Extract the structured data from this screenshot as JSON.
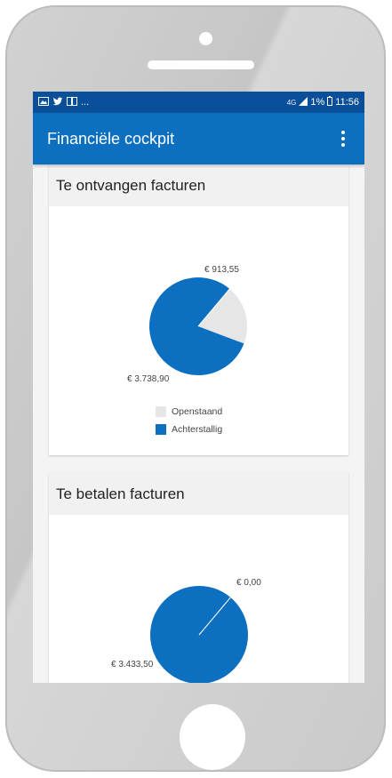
{
  "statusbar": {
    "left_icons": [
      "image-icon",
      "twitter-icon",
      "book-icon"
    ],
    "ellipsis": "...",
    "signal": "4G",
    "battery": "1%",
    "time": "11:56"
  },
  "appbar": {
    "title": "Financiële cockpit",
    "menu_icon": "more-vert-icon"
  },
  "cards": [
    {
      "title": "Te ontvangen facturen",
      "chart_data": {
        "type": "pie",
        "slices": [
          {
            "label": "Openstaand",
            "value": 913.55,
            "value_label": "€ 913,55",
            "color": "#e6e6e6"
          },
          {
            "label": "Achterstallig",
            "value": 3738.9,
            "value_label": "€ 3.738,90",
            "color": "#0d6fc0"
          }
        ],
        "legend": [
          "Openstaand",
          "Achterstallig"
        ]
      }
    },
    {
      "title": "Te betalen facturen",
      "chart_data": {
        "type": "pie",
        "slices": [
          {
            "label": "",
            "value": 0.0,
            "value_label": "€ 0,00",
            "color": "#e6e6e6"
          },
          {
            "label": "",
            "value": 3433.5,
            "value_label": "€ 3.433,50",
            "color": "#0d6fc0"
          }
        ]
      }
    }
  ],
  "colors": {
    "statusbar": "#0a4f9a",
    "appbar": "#0d6fc0",
    "accent": "#0d6fc0",
    "muted_slice": "#e6e6e6"
  }
}
